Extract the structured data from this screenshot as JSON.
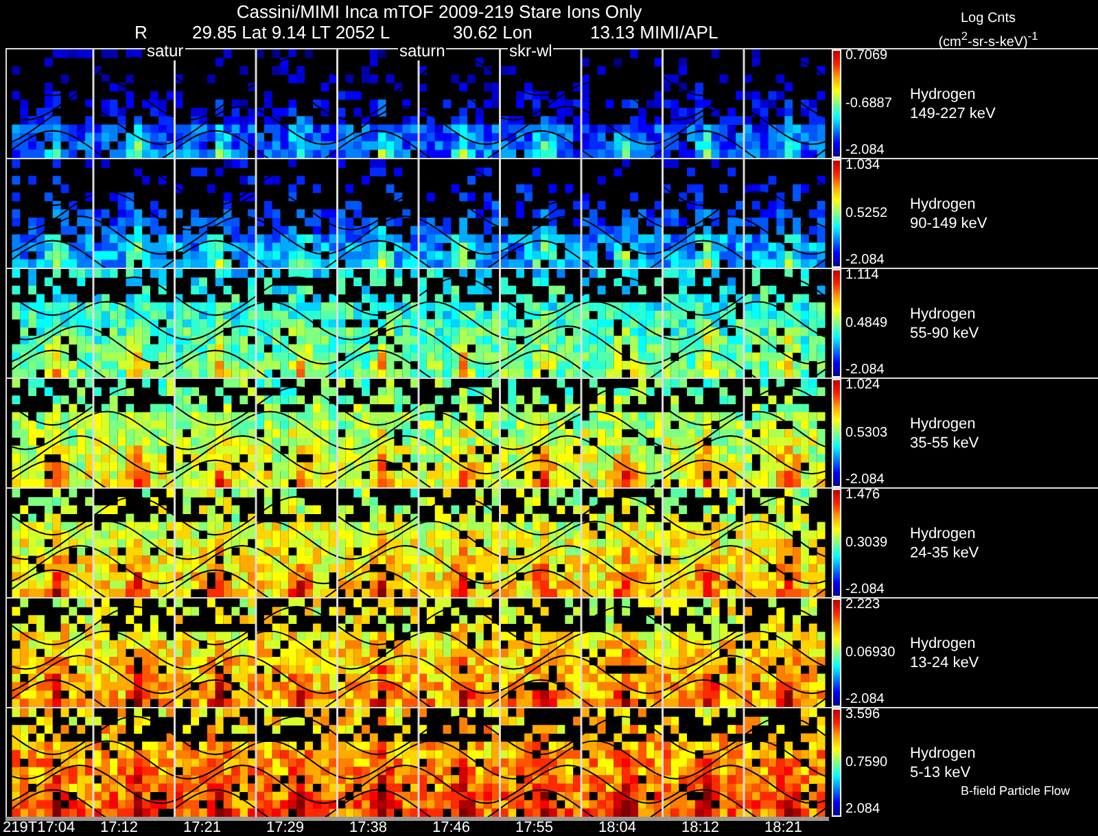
{
  "header": {
    "title": "Cassini/MIMI Inca mTOF  2009-219   Stare   Ions Only",
    "position": [
      "R",
      "29.85 Lat 9.14 LT 2052 L",
      "30.62 Lon",
      "13.13  MIMI/APL"
    ],
    "markers": [
      "satur",
      "saturn",
      "skr-wl"
    ]
  },
  "units": {
    "line_1": "Log Cnts",
    "line_2": "(cm$^{2}$-sr-s-keV)$^{-1}$"
  },
  "panels": [
    {
      "species": "Hydrogen",
      "energy": "149-227 keV",
      "scale_max": "0.7069",
      "scale_mid": "-0.6887",
      "scale_min": "-2.084"
    },
    {
      "species": "Hydrogen",
      "energy": "90-149 keV",
      "scale_max": "1.034",
      "scale_mid": "0.5252",
      "scale_min": "-2.084"
    },
    {
      "species": "Hydrogen",
      "energy": "55-90 keV",
      "scale_max": "1.114",
      "scale_mid": "0.4849",
      "scale_min": "-2.084"
    },
    {
      "species": "Hydrogen",
      "energy": "35-55 keV",
      "scale_max": "1.024",
      "scale_mid": "0.5303",
      "scale_min": "-2.084"
    },
    {
      "species": "Hydrogen",
      "energy": "24-35 keV",
      "scale_max": "1.476",
      "scale_mid": "0.3039",
      "scale_min": "-2.084"
    },
    {
      "species": "Hydrogen",
      "energy": "13-24 keV",
      "scale_max": "2.223",
      "scale_mid": "0.06930",
      "scale_min": "-2.084"
    },
    {
      "species": "Hydrogen",
      "energy": "5-13 keV",
      "scale_max": "3.596",
      "scale_mid": "0.7590",
      "scale_min": "2.084"
    }
  ],
  "footnote": "B-field Particle Flow",
  "times": [
    "219T17:04",
    "17:12",
    "17:21",
    "17:29",
    "17:38",
    "17:46",
    "17:55",
    "18:04",
    "18:12",
    "18:21"
  ]
}
